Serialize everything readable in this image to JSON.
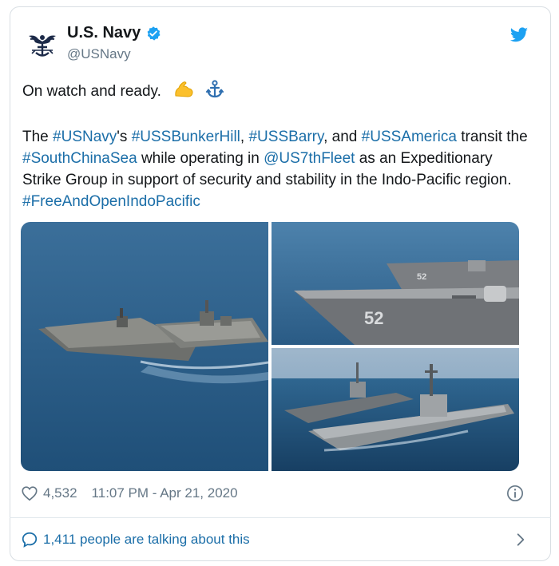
{
  "author": {
    "name": "U.S. Navy",
    "handle": "@USNavy",
    "verified": true,
    "avatar_icon": "navy-eagle-emblem-icon"
  },
  "tweet": {
    "line1": "On watch and ready.",
    "line1_emojis": [
      "💪",
      "⚓"
    ],
    "p_the": "The ",
    "tag_usnavy": "#USNavy",
    "t_s": "'s ",
    "tag_bunkerhill": "#USSBunkerHill",
    "t_comma1": ", ",
    "tag_barry": "#USSBarry",
    "t_and": ", and ",
    "tag_america": "#USSAmerica",
    "t_transit": " transit the ",
    "tag_scs": "#SouthChinaSea",
    "t_while": " while operating in ",
    "mention_7th": "@US7thFleet",
    "t_rest": " as an Expeditionary Strike Group in support of security and stability in the Indo-Pacific region.  ",
    "tag_foip": "#FreeAndOpenIndoPacific"
  },
  "media": {
    "hull_number": "52",
    "hull_number_far": "52"
  },
  "meta": {
    "likes": "4,532",
    "timestamp": "11:07 PM - Apr 21, 2020"
  },
  "footer": {
    "talking": "1,411 people are talking about this"
  },
  "colors": {
    "link": "#1b6ea8",
    "twitter_blue": "#1da1f2",
    "muted": "#657786"
  }
}
